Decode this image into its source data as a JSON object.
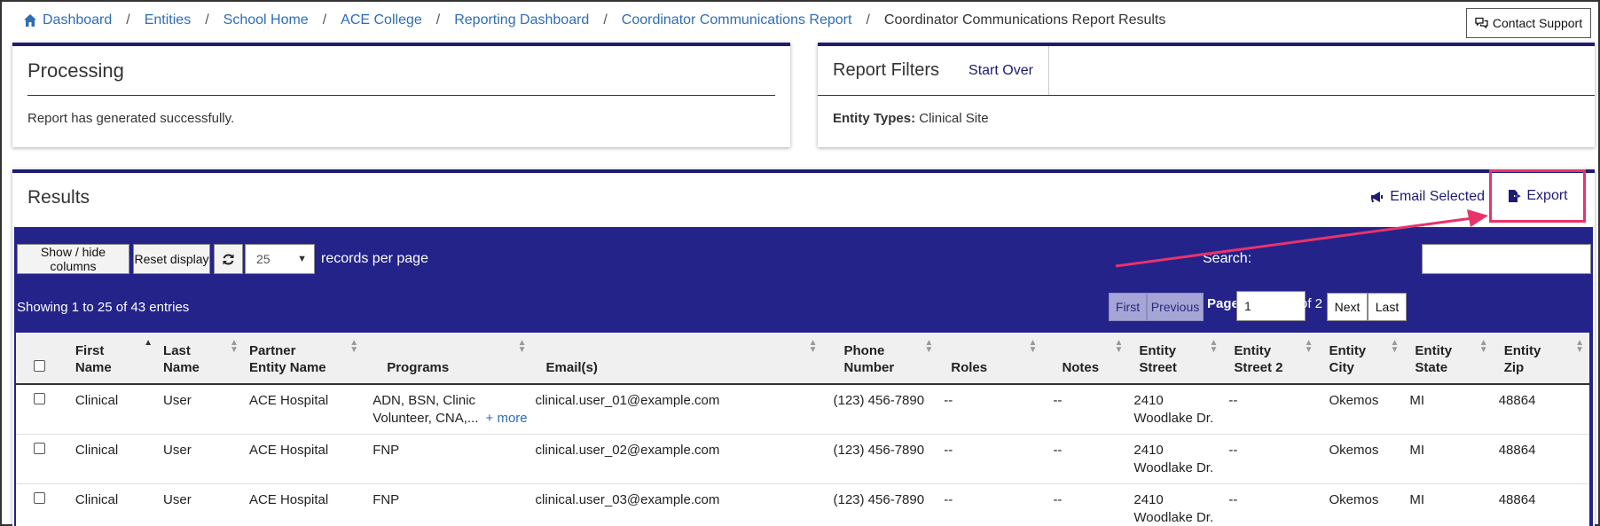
{
  "breadcrumb": {
    "items": [
      "Dashboard",
      "Entities",
      "School Home",
      "ACE College",
      "Reporting Dashboard",
      "Coordinator Communications Report"
    ],
    "current": "Coordinator Communications Report Results",
    "separator": "/"
  },
  "contact_support": "Contact Support",
  "processing": {
    "title": "Processing",
    "message": "Report has generated successfully."
  },
  "filters": {
    "title": "Report Filters",
    "start_over": "Start Over",
    "label": "Entity Types:",
    "value": "Clinical Site"
  },
  "results": {
    "title": "Results",
    "email_selected": "Email Selected",
    "export": "Export",
    "show_hide": "Show / hide columns",
    "reset": "Reset display",
    "per_page_value": "25",
    "records_per_page": "records per page",
    "search_label": "Search:",
    "showing": "Showing 1 to 25 of 43 entries",
    "pager": {
      "first": "First",
      "previous": "Previous",
      "page_label": "Page",
      "page_value": "1",
      "of": "of 2",
      "next": "Next",
      "last": "Last"
    },
    "columns": [
      [
        "First",
        "Name"
      ],
      [
        "Last",
        "Name"
      ],
      [
        "Partner",
        "Entity Name"
      ],
      [
        "",
        "Programs"
      ],
      [
        "",
        "Email(s)"
      ],
      [
        "Phone",
        "Number"
      ],
      [
        "",
        "Roles"
      ],
      [
        "",
        "Notes"
      ],
      [
        "Entity",
        "Street"
      ],
      [
        "Entity",
        "Street 2"
      ],
      [
        "Entity",
        "City"
      ],
      [
        "Entity",
        "State"
      ],
      [
        "Entity",
        "Zip"
      ]
    ],
    "rows": [
      {
        "first": "Clinical",
        "last": "User",
        "partner": "ACE Hospital",
        "programs": "ADN, BSN, Clinic Volunteer, CNA,...",
        "more": "+ more",
        "email": "clinical.user_01@example.com",
        "phone": "(123) 456-7890",
        "roles": "--",
        "notes": "--",
        "street": "2410 Woodlake Dr.",
        "street2": "--",
        "city": "Okemos",
        "state": "MI",
        "zip": "48864"
      },
      {
        "first": "Clinical",
        "last": "User",
        "partner": "ACE Hospital",
        "programs": "FNP",
        "more": "",
        "email": "clinical.user_02@example.com",
        "phone": "(123) 456-7890",
        "roles": "--",
        "notes": "--",
        "street": "2410 Woodlake Dr.",
        "street2": "--",
        "city": "Okemos",
        "state": "MI",
        "zip": "48864"
      },
      {
        "first": "Clinical",
        "last": "User",
        "partner": "ACE Hospital",
        "programs": "FNP",
        "more": "",
        "email": "clinical.user_03@example.com",
        "phone": "(123) 456-7890",
        "roles": "--",
        "notes": "--",
        "street": "2410 Woodlake Dr.",
        "street2": "--",
        "city": "Okemos",
        "state": "MI",
        "zip": "48864"
      }
    ]
  },
  "colors": {
    "navy": "#1c1c73",
    "toolbar": "#23238a",
    "link": "#2f6db5",
    "highlight": "#e8336b"
  },
  "icons": [
    "home-icon",
    "chat-icon",
    "megaphone-icon",
    "file-export-icon",
    "refresh-icon",
    "sort-icon"
  ]
}
